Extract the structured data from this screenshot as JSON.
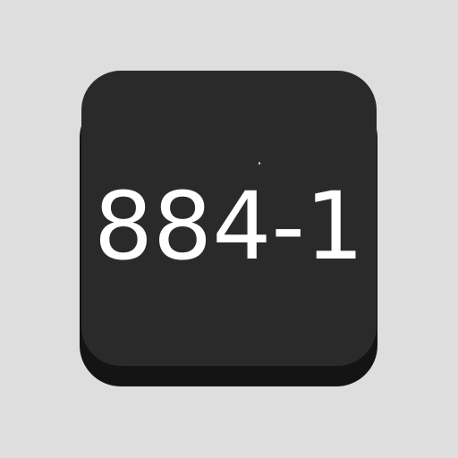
{
  "app_icon": {
    "label": "884-1",
    "icon_name": "app-icon-tile",
    "colors": {
      "background": "#dedede",
      "tile_face": "#2b2a2b",
      "tile_shadow": "#141414",
      "label": "#ffffff"
    }
  }
}
